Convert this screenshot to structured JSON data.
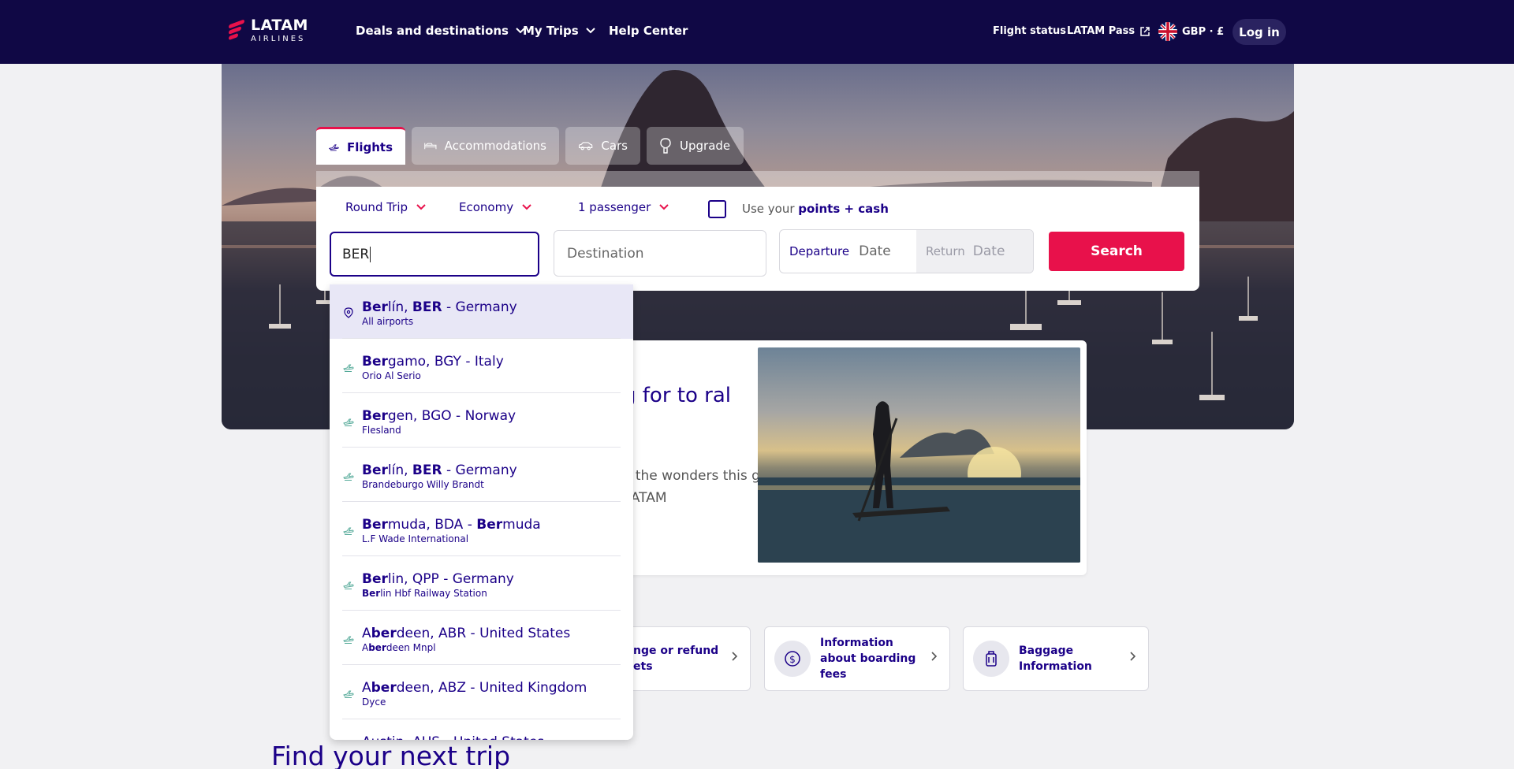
{
  "header": {
    "logo_main": "LATAM",
    "logo_sub": "AIRLINES",
    "nav": [
      {
        "label": "Deals and destinations",
        "has_chevron": true
      },
      {
        "label": "My Trips",
        "has_chevron": true
      },
      {
        "label": "Help Center",
        "has_chevron": false
      }
    ],
    "flight_status": "Flight status",
    "latam_pass": "LATAM Pass",
    "currency": "GBP · £",
    "login": "Log in"
  },
  "tabs": [
    {
      "label": "Flights",
      "icon": "plane-icon",
      "active": true
    },
    {
      "label": "Accommodations",
      "icon": "bed-icon",
      "active": false
    },
    {
      "label": "Cars",
      "icon": "car-icon",
      "active": false
    },
    {
      "label": "Upgrade",
      "icon": "upgrade-icon",
      "active": false
    }
  ],
  "search": {
    "trip_type": "Round Trip",
    "cabin": "Economy",
    "passengers": "1 passenger",
    "points_prefix": "Use your ",
    "points_bold": "points + cash",
    "origin_value": "BER",
    "destination_placeholder": "Destination",
    "departure_label": "Departure",
    "departure_placeholder": "Date",
    "return_label": "Return",
    "return_placeholder": "Date",
    "button": "Search"
  },
  "dropdown": {
    "items": [
      {
        "parts": [
          {
            "t": "Ber",
            "b": true
          },
          {
            "t": "lín, ",
            "b": false
          },
          {
            "t": "BER",
            "b": true
          },
          {
            "t": " - Germany",
            "b": false
          }
        ],
        "sub": [
          {
            "t": "All airports",
            "b": false
          }
        ],
        "icon": "location-pin-icon",
        "selected": true
      },
      {
        "parts": [
          {
            "t": "Ber",
            "b": true
          },
          {
            "t": "gamo, BGY - Italy",
            "b": false
          }
        ],
        "sub": [
          {
            "t": "Orio Al Serio",
            "b": false
          }
        ],
        "icon": "plane-small-icon",
        "selected": false
      },
      {
        "parts": [
          {
            "t": "Ber",
            "b": true
          },
          {
            "t": "gen, BGO - Norway",
            "b": false
          }
        ],
        "sub": [
          {
            "t": "Flesland",
            "b": false
          }
        ],
        "icon": "plane-small-icon",
        "selected": false
      },
      {
        "parts": [
          {
            "t": "Ber",
            "b": true
          },
          {
            "t": "lín, ",
            "b": false
          },
          {
            "t": "BER",
            "b": true
          },
          {
            "t": " - Germany",
            "b": false
          }
        ],
        "sub": [
          {
            "t": "Brandeburgo Willy Brandt",
            "b": false
          }
        ],
        "icon": "plane-small-icon",
        "selected": false
      },
      {
        "parts": [
          {
            "t": "Ber",
            "b": true
          },
          {
            "t": "muda, BDA - ",
            "b": false
          },
          {
            "t": "Ber",
            "b": true
          },
          {
            "t": "muda",
            "b": false
          }
        ],
        "sub": [
          {
            "t": "L.F Wade International",
            "b": false
          }
        ],
        "icon": "plane-small-icon",
        "selected": false
      },
      {
        "parts": [
          {
            "t": "Ber",
            "b": true
          },
          {
            "t": "lin, QPP - Germany",
            "b": false
          }
        ],
        "sub": [
          {
            "t": "Ber",
            "b": true
          },
          {
            "t": "lin Hbf Railway Station",
            "b": false
          }
        ],
        "icon": "plane-small-icon",
        "selected": false
      },
      {
        "parts": [
          {
            "t": "A",
            "b": false
          },
          {
            "t": "ber",
            "b": true
          },
          {
            "t": "deen, ABR - United States",
            "b": false
          }
        ],
        "sub": [
          {
            "t": "A",
            "b": false
          },
          {
            "t": "ber",
            "b": true
          },
          {
            "t": "deen Mnpl",
            "b": false
          }
        ],
        "icon": "plane-small-icon",
        "selected": false
      },
      {
        "parts": [
          {
            "t": "A",
            "b": false
          },
          {
            "t": "ber",
            "b": true
          },
          {
            "t": "deen, ABZ - United Kingdom",
            "b": false
          }
        ],
        "sub": [
          {
            "t": "Dyce",
            "b": false
          }
        ],
        "icon": "plane-small-icon",
        "selected": false
      },
      {
        "parts": [
          {
            "t": "Austin, AUS - United States",
            "b": false
          }
        ],
        "sub": [],
        "icon": "plane-small-icon",
        "selected": false
      }
    ]
  },
  "promo": {
    "title": "g for to ral",
    "text": "e the wonders this g with LATAM"
  },
  "info_cards": [
    {
      "label": "nge or refund ets",
      "icon": "refund-icon"
    },
    {
      "label": "Information about boarding fees",
      "icon": "fees-icon"
    },
    {
      "label": "Baggage Information",
      "icon": "baggage-icon"
    }
  ],
  "find_trip": "Find your next trip",
  "colors": {
    "navy": "#100845",
    "brand_blue": "#1b0088",
    "brand_red": "#e8114b"
  }
}
